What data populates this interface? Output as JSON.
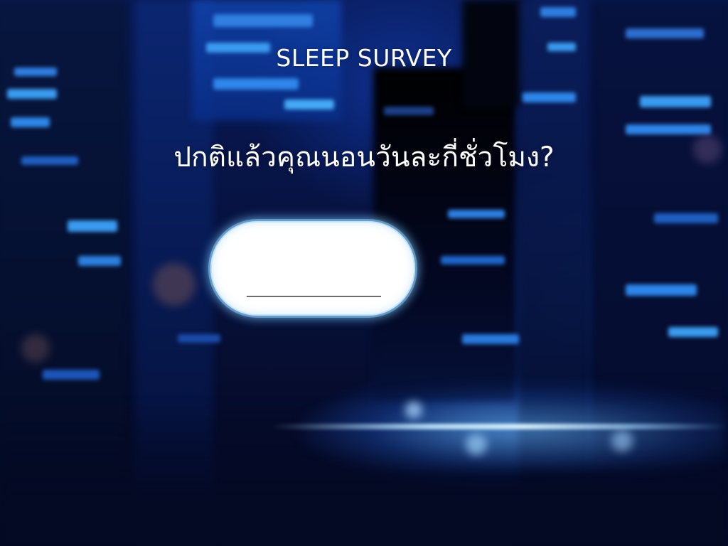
{
  "survey": {
    "title": "SLEEP SURVEY",
    "question": "ปกติแล้วคุณนอนวันละกี่ชั่วโมง?",
    "answer_value": ""
  },
  "theme": {
    "text_color": "#ffffff",
    "answer_box_fill": "#ffffff",
    "answer_box_glow": "#78c8ff",
    "background_dark": "#050a24",
    "background_blue": "#091a55"
  },
  "background": {
    "description_icon": "night-city-skyline-background"
  }
}
